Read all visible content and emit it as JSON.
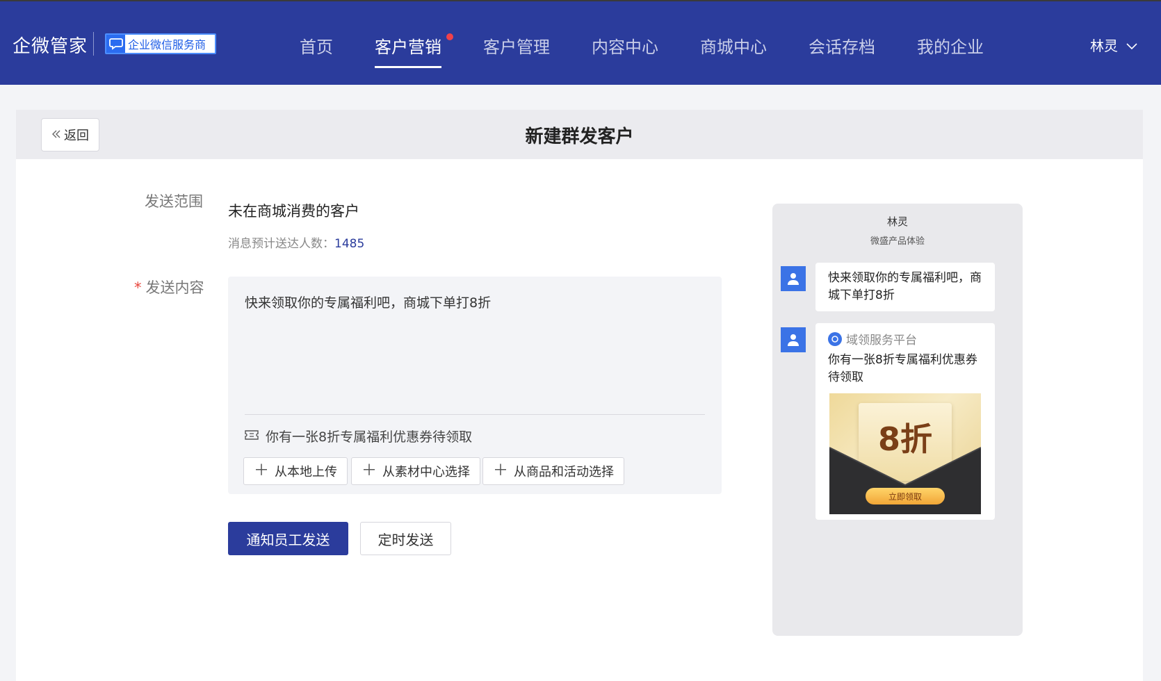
{
  "header": {
    "logo": "企微管家",
    "partner_badge": "企业微信服务商",
    "nav": [
      {
        "label": "首页",
        "active": false
      },
      {
        "label": "客户营销",
        "active": true
      },
      {
        "label": "客户管理",
        "active": false
      },
      {
        "label": "内容中心",
        "active": false
      },
      {
        "label": "商城中心",
        "active": false
      },
      {
        "label": "会话存档",
        "active": false
      },
      {
        "label": "我的企业",
        "active": false
      }
    ],
    "user_name": "林灵"
  },
  "page": {
    "back_label": "返回",
    "title": "新建群发客户"
  },
  "form": {
    "scope_label": "发送范围",
    "scope_value": "未在商城消费的客户",
    "reach_label": "消息预计送达人数：",
    "reach_count": "1485",
    "content_required_mark": "*",
    "content_label": "发送内容",
    "content_text": "快来领取你的专属福利吧，商城下单打8折",
    "attachment_text": "你有一张8折专属福利优惠券待领取",
    "add_buttons": [
      "从本地上传",
      "从素材中心选择",
      "从商品和活动选择"
    ],
    "submit_label": "通知员工发送",
    "schedule_label": "定时发送"
  },
  "preview": {
    "sender_name": "林灵",
    "corp_name": "微盛产品体验",
    "message_text": "快来领取你的专属福利吧，商城下单打8折",
    "mini_program_name": "域领服务平台",
    "mini_program_title": "你有一张8折专属福利优惠券待领取",
    "coupon_discount": "8折",
    "coupon_button": "立即领取"
  },
  "colors": {
    "nav_bg": "#2b3c9c",
    "primary": "#2b3c9c",
    "required": "#e8453c",
    "notification_dot": "#f0414a"
  }
}
